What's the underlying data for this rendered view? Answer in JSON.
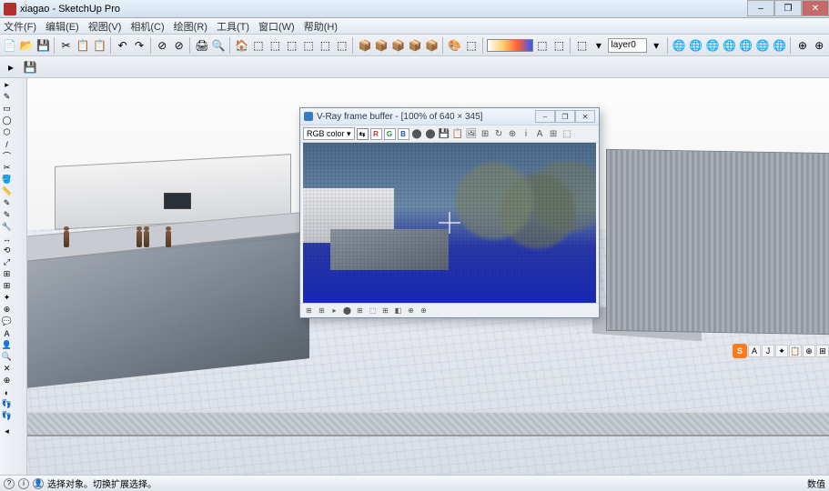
{
  "window": {
    "title": "xiagao - SketchUp Pro",
    "controls": {
      "min": "–",
      "max": "❐",
      "close": "✕"
    }
  },
  "menu": [
    "文件(F)",
    "编辑(E)",
    "视图(V)",
    "相机(C)",
    "绘图(R)",
    "工具(T)",
    "窗口(W)",
    "帮助(H)"
  ],
  "toolbar1_icons": [
    "📄",
    "📂",
    "💾",
    "|",
    "✂",
    "📋",
    "📋",
    "|",
    "↶",
    "↷",
    "|",
    "⊘",
    "⊘",
    "|",
    "🖨",
    "🔍",
    "|",
    "🏠",
    "⬚",
    "⬚",
    "⬚",
    "⬚",
    "⬚",
    "⬚",
    "|",
    "📦",
    "📦",
    "📦",
    "📦",
    "📦",
    "|",
    "🎨",
    "⬚",
    "|",
    "grad",
    "⬚",
    "⬚",
    "|",
    "⬚",
    "▾",
    "layer",
    "▾",
    "|",
    "🌐",
    "🌐",
    "🌐",
    "🌐",
    "🌐",
    "🌐",
    "🌐",
    "|",
    "⊕",
    "⊕"
  ],
  "toolbar2_icons": [
    "▸",
    "💾"
  ],
  "layer_label": "layer0",
  "left_icons": [
    "▸",
    "✎",
    "▭",
    "◯",
    "⬡",
    "/",
    "⌒",
    "✂",
    "🪣",
    "📏",
    "✎",
    "✎",
    "🔧",
    "↔",
    "⟲",
    "⤢",
    "⊞",
    "⊞",
    "✦",
    "⊕",
    "💬",
    "A",
    "👤",
    "🔍",
    "✕",
    "⊕",
    "◐",
    "👣",
    "👣",
    "|",
    "◂"
  ],
  "render": {
    "title": "V-Ray frame buffer - [100% of 640 × 345]",
    "controls": {
      "min": "–",
      "max": "❐",
      "close": "✕"
    },
    "dropdown": "RGB color ▾",
    "channels": [
      "R",
      "G",
      "B"
    ],
    "tb_icons": [
      "⬤",
      "⬤",
      "💾",
      "📋",
      "🖼",
      "⊞",
      "↻",
      "⊕",
      "i",
      "A",
      "⊞",
      "⬚"
    ],
    "status_icons": [
      "⊞",
      "⊞",
      "▸",
      "⬤",
      "⊞",
      "⬚",
      "⊞",
      "◧",
      "⊕",
      "⊕"
    ]
  },
  "right_float": {
    "s": "S",
    "items": [
      "A",
      "J",
      "✦",
      "📋",
      "⊕",
      "⊞"
    ]
  },
  "status": {
    "hint": "选择对象。切换扩展选择。",
    "right": "数值"
  }
}
